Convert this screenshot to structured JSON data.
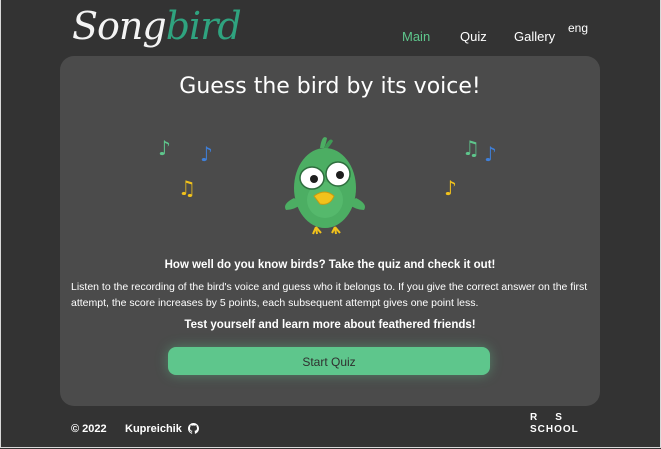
{
  "header": {
    "logo": {
      "part1": "Song",
      "part2": "bird"
    },
    "nav": [
      {
        "label": "Main",
        "active": true
      },
      {
        "label": "Quiz",
        "active": false
      },
      {
        "label": "Gallery",
        "active": false
      }
    ],
    "language": "eng"
  },
  "main": {
    "title": "Guess the bird by its voice!",
    "lead": "How well do you know birds? Take the quiz and check it out!",
    "description": "Listen to the recording of the bird's voice and guess who it belongs to. If you give the correct answer on the first attempt, the score increases by 5 points, each subsequent attempt gives one point less.",
    "tagline": "Test yourself and learn more about feathered friends!",
    "start_button": "Start Quiz",
    "notes": [
      "♪",
      "♪",
      "♫",
      "♫",
      "♪",
      "♪"
    ]
  },
  "footer": {
    "copyright": "© 2022",
    "author": "Kupreichik",
    "school_logo": {
      "row1": "RS",
      "row2": "SCHOOL"
    }
  },
  "colors": {
    "background": "#333333",
    "card": "#4b4b4b",
    "accent_green": "#5ec68c",
    "logo_green": "#2fa37f",
    "note_blue": "#3f7fd8",
    "note_yellow": "#f2c21b",
    "bird_green": "#4cae63"
  },
  "icons": {
    "github": "github-icon",
    "music_note": "music-note-icon",
    "bird": "bird-mascot"
  }
}
